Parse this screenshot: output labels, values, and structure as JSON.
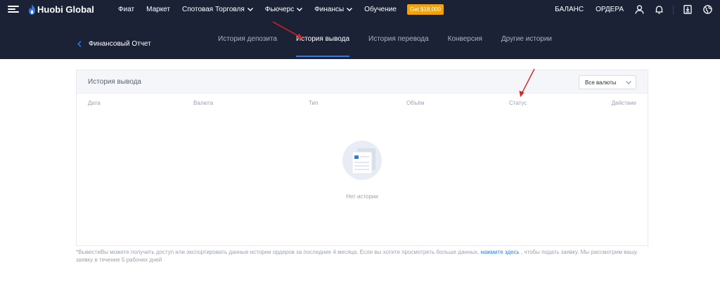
{
  "brand": {
    "name": "Huobi Global"
  },
  "topnav": {
    "items": [
      {
        "label": "Фиат",
        "dropdown": false
      },
      {
        "label": "Маркет",
        "dropdown": false
      },
      {
        "label": "Спотовая Торговля",
        "dropdown": true
      },
      {
        "label": "Фьючерс",
        "dropdown": true
      },
      {
        "label": "Финансы",
        "dropdown": true
      },
      {
        "label": "Обучение",
        "dropdown": false
      }
    ],
    "promo": "Get $18,000",
    "right": {
      "balance": "БАЛАНС",
      "orders": "ОРДЕРА"
    },
    "icons": [
      "user-icon",
      "bell-icon",
      "download-icon",
      "globe-icon"
    ]
  },
  "subheader": {
    "title": "Финансовый Отчет",
    "tabs": [
      {
        "label": "История депозита",
        "active": false
      },
      {
        "label": "История вывода",
        "active": true
      },
      {
        "label": "История перевода",
        "active": false
      },
      {
        "label": "Конверсия",
        "active": false
      },
      {
        "label": "Другие истории",
        "active": false
      }
    ]
  },
  "card": {
    "title": "История вывода",
    "currency_select": "Все валюты",
    "columns": [
      "Дата",
      "Валюта",
      "Тип",
      "Объём",
      "Статус",
      "Действие"
    ],
    "empty_text": "Нет истории"
  },
  "footnote": {
    "before": "*ВывестиВы можете получить доступ или экспортировать данные истории ордеров за последние 4 месяца. Если вы хотите просмотреть больше данных, ",
    "link": "нажмите здесь",
    "after": " , чтобы подать заявку. Мы рассмотрим вашу заявку в течение 5 рабочих дней"
  },
  "colors": {
    "nav_bg": "#1b2236",
    "accent": "#2f7ce9",
    "promo": "#f0a30a",
    "annotation": "#e02020"
  }
}
